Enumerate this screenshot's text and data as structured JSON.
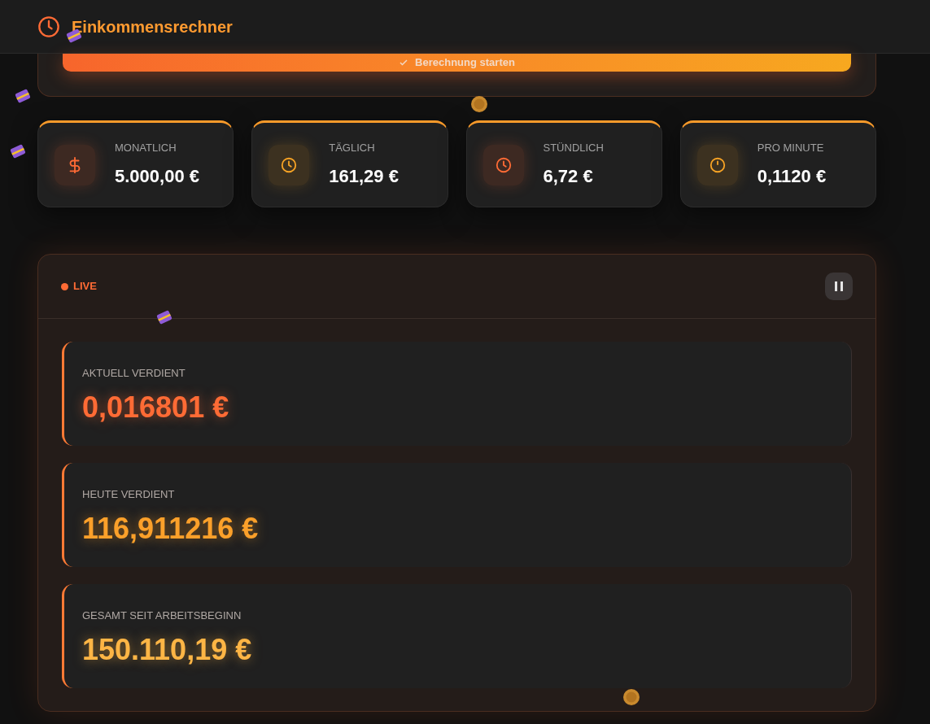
{
  "header": {
    "title": "Einkommensrechner"
  },
  "start_button": {
    "label": "Berechnung starten"
  },
  "stats": [
    {
      "kind": "dollar",
      "label": "MONATLICH",
      "value": "5.000,00 €",
      "color": "#ff6b35"
    },
    {
      "kind": "clock",
      "label": "TÄGLICH",
      "value": "161,29 €",
      "color": "#f7a325"
    },
    {
      "kind": "clock",
      "label": "STÜNDLICH",
      "value": "6,72 €",
      "color": "#ff6b35"
    },
    {
      "kind": "timer",
      "label": "PRO MINUTE",
      "value": "0,1120 €",
      "color": "#f7a325"
    }
  ],
  "live": {
    "status": "LIVE",
    "running": true,
    "counters": [
      {
        "label": "AKTUELL VERDIENT",
        "value": "0,016801 €",
        "color": "#ff6b35"
      },
      {
        "label": "HEUTE VERDIENT",
        "value": "116,911216 €",
        "color": "#fba02a"
      },
      {
        "label": "GESAMT SEIT ARBEITSBEGINN",
        "value": "150.110,19 €",
        "color": "#fdb545"
      }
    ]
  }
}
